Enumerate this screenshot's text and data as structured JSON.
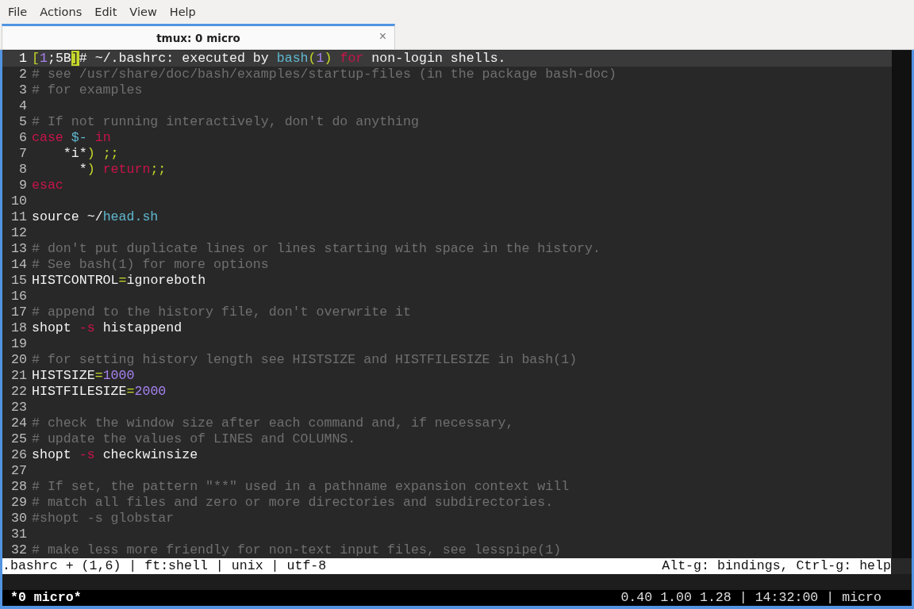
{
  "menu": [
    "File",
    "Actions",
    "Edit",
    "View",
    "Help"
  ],
  "tab": {
    "title": "tmux: 0 micro",
    "close": "×"
  },
  "lines": [
    {
      "number": "1",
      "current": true,
      "tokens": [
        {
          "text": "[",
          "kind": "operator"
        },
        {
          "text": "1",
          "kind": "number"
        },
        {
          "text": ";5B",
          "kind": "plain"
        },
        {
          "text": "]",
          "kind": "cursor"
        },
        {
          "text": "# ~/.bashrc: executed by ",
          "kind": "plain"
        },
        {
          "text": "bash",
          "kind": "builtin"
        },
        {
          "text": "(",
          "kind": "operator"
        },
        {
          "text": "1",
          "kind": "number"
        },
        {
          "text": ") ",
          "kind": "operator"
        },
        {
          "text": "for",
          "kind": "keyword"
        },
        {
          "text": " non-login shells.",
          "kind": "plain"
        }
      ]
    },
    {
      "number": "2",
      "current": false,
      "tokens": [
        {
          "text": "# see /usr/share/doc/bash/examples/startup-files (in the package bash-doc)",
          "kind": "comment"
        }
      ]
    },
    {
      "number": "3",
      "current": false,
      "tokens": [
        {
          "text": "# for examples",
          "kind": "comment"
        }
      ]
    },
    {
      "number": "4",
      "current": false
    },
    {
      "number": "5",
      "current": false,
      "tokens": [
        {
          "text": "# If not running interactively, don't do anything",
          "kind": "comment"
        }
      ]
    },
    {
      "number": "6",
      "current": false,
      "tokens": [
        {
          "text": "case ",
          "kind": "keyword"
        },
        {
          "text": "$- ",
          "kind": "builtin"
        },
        {
          "text": "in",
          "kind": "keyword"
        }
      ]
    },
    {
      "number": "7",
      "current": false,
      "tokens": [
        {
          "text": "    *i*",
          "kind": "plain"
        },
        {
          "text": ") ;;",
          "kind": "operator"
        }
      ]
    },
    {
      "number": "8",
      "current": false,
      "tokens": [
        {
          "text": "      *",
          "kind": "plain"
        },
        {
          "text": ") ",
          "kind": "operator"
        },
        {
          "text": "return",
          "kind": "keyword"
        },
        {
          "text": ";;",
          "kind": "operator"
        }
      ]
    },
    {
      "number": "9",
      "current": false,
      "tokens": [
        {
          "text": "esac",
          "kind": "keyword"
        }
      ]
    },
    {
      "number": "10",
      "current": false
    },
    {
      "number": "11",
      "current": false,
      "tokens": [
        {
          "text": "source ~/",
          "kind": "plain"
        },
        {
          "text": "head.sh",
          "kind": "builtin"
        }
      ]
    },
    {
      "number": "12",
      "current": false
    },
    {
      "number": "13",
      "current": false,
      "tokens": [
        {
          "text": "# don't put duplicate lines or lines starting with space in the history.",
          "kind": "comment"
        }
      ]
    },
    {
      "number": "14",
      "current": false,
      "tokens": [
        {
          "text": "# See bash(1) for more options",
          "kind": "comment"
        }
      ]
    },
    {
      "number": "15",
      "current": false,
      "tokens": [
        {
          "text": "HISTCONTROL",
          "kind": "plain"
        },
        {
          "text": "=",
          "kind": "operator"
        },
        {
          "text": "ignoreboth",
          "kind": "plain"
        }
      ]
    },
    {
      "number": "16",
      "current": false
    },
    {
      "number": "17",
      "current": false,
      "tokens": [
        {
          "text": "# append to the history file, don't overwrite it",
          "kind": "comment"
        }
      ]
    },
    {
      "number": "18",
      "current": false,
      "tokens": [
        {
          "text": "shopt ",
          "kind": "plain"
        },
        {
          "text": "-s",
          "kind": "keyword"
        },
        {
          "text": " histappend",
          "kind": "plain"
        }
      ]
    },
    {
      "number": "19",
      "current": false
    },
    {
      "number": "20",
      "current": false,
      "tokens": [
        {
          "text": "# for setting history length see HISTSIZE and HISTFILESIZE in bash(1)",
          "kind": "comment"
        }
      ]
    },
    {
      "number": "21",
      "current": false,
      "tokens": [
        {
          "text": "HISTSIZE",
          "kind": "plain"
        },
        {
          "text": "=",
          "kind": "operator"
        },
        {
          "text": "1000",
          "kind": "number"
        }
      ]
    },
    {
      "number": "22",
      "current": false,
      "tokens": [
        {
          "text": "HISTFILESIZE",
          "kind": "plain"
        },
        {
          "text": "=",
          "kind": "operator"
        },
        {
          "text": "2000",
          "kind": "number"
        }
      ]
    },
    {
      "number": "23",
      "current": false
    },
    {
      "number": "24",
      "current": false,
      "tokens": [
        {
          "text": "# check the window size after each command and, if necessary,",
          "kind": "comment"
        }
      ]
    },
    {
      "number": "25",
      "current": false,
      "tokens": [
        {
          "text": "# update the values of LINES and COLUMNS.",
          "kind": "comment"
        }
      ]
    },
    {
      "number": "26",
      "current": false,
      "tokens": [
        {
          "text": "shopt ",
          "kind": "plain"
        },
        {
          "text": "-s",
          "kind": "keyword"
        },
        {
          "text": " checkwinsize",
          "kind": "plain"
        }
      ]
    },
    {
      "number": "27",
      "current": false
    },
    {
      "number": "28",
      "current": false,
      "tokens": [
        {
          "text": "# If set, the pattern \"**\" used in a pathname expansion context will",
          "kind": "comment"
        }
      ]
    },
    {
      "number": "29",
      "current": false,
      "tokens": [
        {
          "text": "# match all files and zero or more directories and subdirectories.",
          "kind": "comment"
        }
      ]
    },
    {
      "number": "30",
      "current": false,
      "tokens": [
        {
          "text": "#shopt -s globstar",
          "kind": "comment"
        }
      ]
    },
    {
      "number": "31",
      "current": false
    },
    {
      "number": "32",
      "current": false,
      "tokens": [
        {
          "text": "# make less more friendly for non-text input files, see lesspipe(1)",
          "kind": "comment"
        }
      ]
    }
  ],
  "status_line": {
    "left": ".bashrc + (1,6) | ft:shell | unix | utf-8",
    "right": "Alt-g: bindings, Ctrl-g: help"
  },
  "tmux_bar": {
    "left": "*0 micro*",
    "right": "0.40 1.00 1.28 | 14:32:00 | micro"
  }
}
